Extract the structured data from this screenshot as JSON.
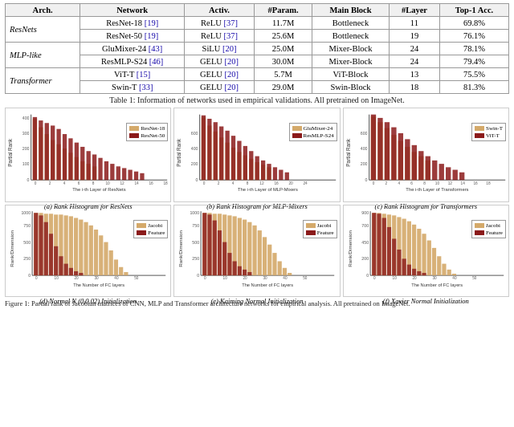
{
  "table": {
    "headers": [
      "Arch.",
      "Network",
      "Activ.",
      "#Param.",
      "Main Block",
      "#Layer",
      "Top-1 Acc."
    ],
    "rows": [
      {
        "arch": "ResNets",
        "rowspan": 2,
        "entries": [
          [
            "ResNet-18 [19]",
            "ReLU [37]",
            "11.7M",
            "Bottleneck",
            "11",
            "69.8%"
          ],
          [
            "ResNet-50 [19]",
            "ReLU [37]",
            "25.6M",
            "Bottleneck",
            "19",
            "76.1%"
          ]
        ]
      },
      {
        "arch": "MLP-like",
        "rowspan": 2,
        "entries": [
          [
            "GluMixer-24 [43]",
            "SiLU [20]",
            "25.0M",
            "Mixer-Block",
            "24",
            "78.1%"
          ],
          [
            "ResMLP-S24 [46]",
            "GELU [20]",
            "30.0M",
            "Mixer-Block",
            "24",
            "79.4%"
          ]
        ]
      },
      {
        "arch": "Transformer",
        "rowspan": 2,
        "entries": [
          [
            "ViT-T [15]",
            "GELU [20]",
            "5.7M",
            "ViT-Block",
            "13",
            "75.5%"
          ],
          [
            "Swin-T [33]",
            "GELU [20]",
            "29.0M",
            "Swin-Block",
            "18",
            "81.3%"
          ]
        ]
      }
    ],
    "caption": "Table 1: Information of networks used in empirical validations. All pretrained on ImageNet."
  },
  "charts_row1": [
    {
      "id": "chart-a",
      "legend": [
        "ResNet-18",
        "ResNet-50"
      ],
      "legend_colors": [
        "#d4a96a",
        "#c0392b"
      ],
      "xlabel": "The i-th Layer of ResNets",
      "ylabel": "Partial Rank",
      "ymax": 500,
      "caption": "(a) Rank Histogram for ResNets"
    },
    {
      "id": "chart-b",
      "legend": [
        "GluMixer-24",
        "ResMLP-S24"
      ],
      "legend_colors": [
        "#d4a96a",
        "#c0392b"
      ],
      "xlabel": "The i-th Layer of MLP-Mixers",
      "ylabel": "Partial Rank",
      "ymax": 700,
      "caption": "(b) Rank Histogram for MLP-Mixers"
    },
    {
      "id": "chart-c",
      "legend": [
        "Swin-T",
        "ViT-T"
      ],
      "legend_colors": [
        "#d4a96a",
        "#c0392b"
      ],
      "xlabel": "The i-th Layer of Transformers",
      "ylabel": "Partial Rank",
      "ymax": 750,
      "caption": "(c) Rank Histogram for Transformers"
    }
  ],
  "charts_row2": [
    {
      "id": "chart-d",
      "legend": [
        "Jacobi",
        "Feature"
      ],
      "legend_colors": [
        "#d4a96a",
        "#c0392b"
      ],
      "xlabel": "The Number of FC layers",
      "ylabel": "Rank/Dimension",
      "ymax": 1000,
      "caption": "(d) Normal N (0,0.02) Initialization"
    },
    {
      "id": "chart-e",
      "legend": [
        "Jacobi",
        "Feature"
      ],
      "legend_colors": [
        "#d4a96a",
        "#c0392b"
      ],
      "xlabel": "The Number of FC layers",
      "ylabel": "Rank/Dimension",
      "ymax": 1000,
      "caption": "(e) Kaiming Normal Initialization"
    },
    {
      "id": "chart-f",
      "legend": [
        "Jacobi",
        "Feature"
      ],
      "legend_colors": [
        "#d4a96a",
        "#c0392b"
      ],
      "xlabel": "The Number of FC layers",
      "ylabel": "Rank/Dimension",
      "ymax": 900,
      "caption": "(f) Xavier Normal Initialization"
    }
  ],
  "figure_caption": "Figure 1: Partial rank of Jacobian matrices of CNN, MLP and Transformer architecture networks for..."
}
